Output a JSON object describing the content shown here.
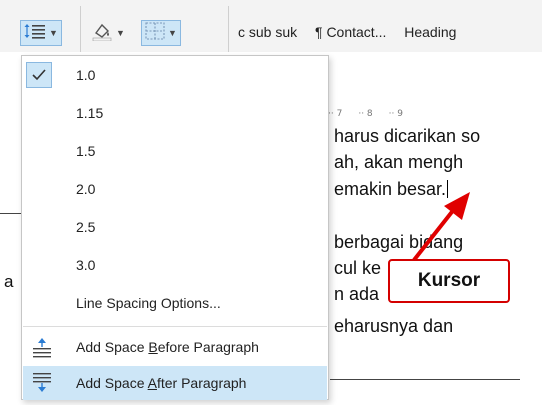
{
  "ribbon": {
    "styles": [
      "c sub suk",
      "¶ Contact...",
      "Heading"
    ],
    "cut_label": "a"
  },
  "document": {
    "lines": [
      "harus dicarikan so",
      "ah, akan mengh",
      "emakin besar.",
      "berbagai bidang",
      "cul ke",
      "n ada",
      "eharusnya  dan"
    ],
    "left_letter": "a",
    "ruler": [
      "7",
      "8",
      "9"
    ],
    "callout": "Kursor"
  },
  "menu": {
    "spacing_options": [
      "1.0",
      "1.15",
      "1.5",
      "2.0",
      "2.5",
      "3.0"
    ],
    "selected_value": "1.0",
    "options_label": "Line Spacing Options...",
    "before_prefix": "Add Space ",
    "before_key": "B",
    "before_suffix": "efore Paragraph",
    "after_prefix": "Add Space ",
    "after_key": "A",
    "after_suffix": "fter Paragraph"
  },
  "colors": {
    "highlight": "#cde6f7",
    "callout_border": "#d40000",
    "arrow": "#e00000"
  },
  "icons": [
    "line-spacing-icon",
    "shading-icon",
    "borders-icon",
    "checkmark-icon",
    "add-space-before-icon",
    "add-space-after-icon",
    "arrow-icon"
  ]
}
